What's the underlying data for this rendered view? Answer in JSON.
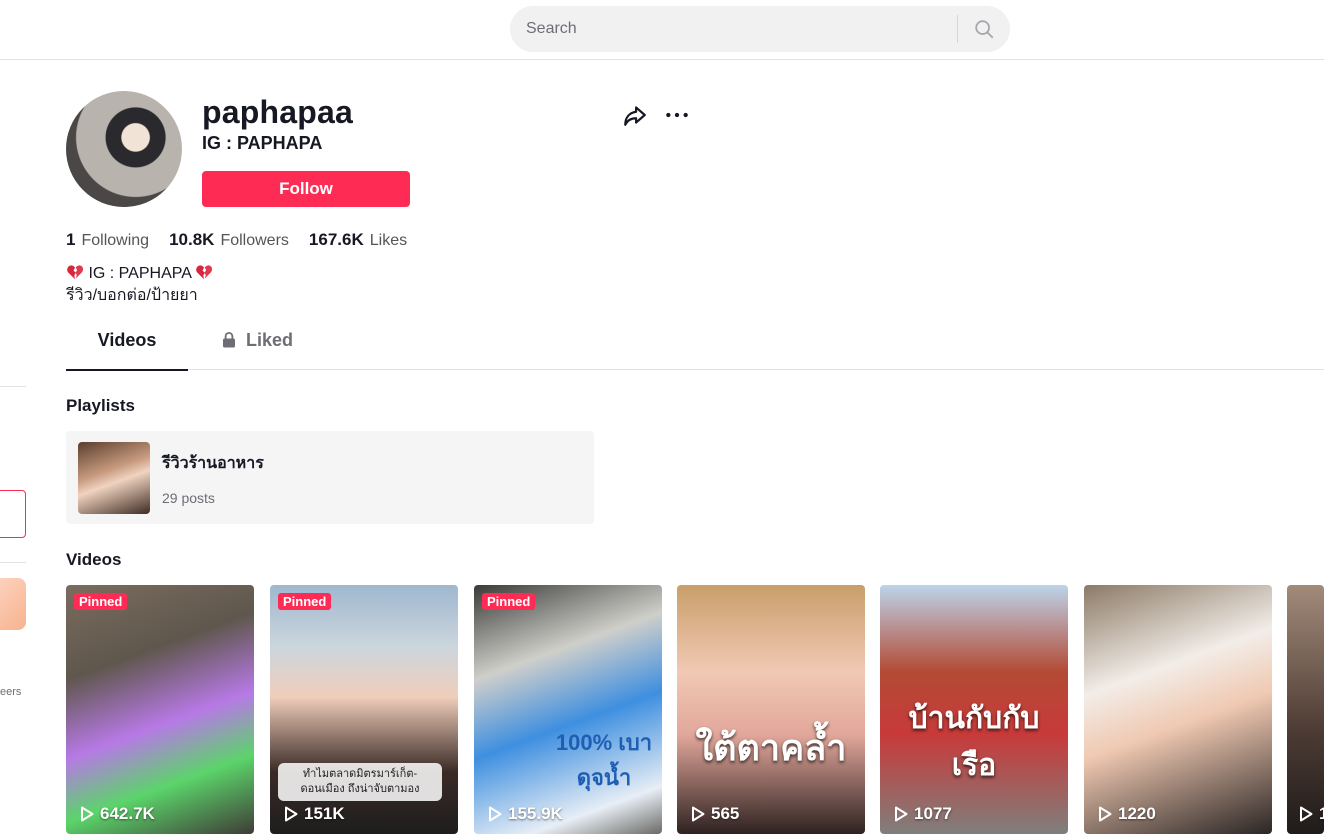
{
  "search": {
    "placeholder": "Search"
  },
  "sidebar": {
    "partial_text": "eers"
  },
  "profile": {
    "username": "paphapaa",
    "nickname": "IG : PAPHAPA",
    "follow_label": "Follow",
    "stats": {
      "following_count": "1",
      "following_label": "Following",
      "followers_count": "10.8K",
      "followers_label": "Followers",
      "likes_count": "167.6K",
      "likes_label": "Likes"
    },
    "bio_line1": "IG : PAPHAPA",
    "bio_line2": "รีวิว/บอกต่อ/ป้ายยา"
  },
  "tabs": {
    "videos": "Videos",
    "liked": "Liked"
  },
  "playlists": {
    "title": "Playlists",
    "items": [
      {
        "name": "รีวิวร้านอาหาร",
        "count": "29 posts"
      }
    ]
  },
  "videos": {
    "title": "Videos",
    "pinned_label": "Pinned",
    "items": [
      {
        "views": "642.7K",
        "pinned": true
      },
      {
        "views": "151K",
        "pinned": true,
        "caption": "ทำไมตลาดมิตรมาร์เก็ต-ดอนเมือง ถึงน่าจับตามอง"
      },
      {
        "views": "155.9K",
        "pinned": true,
        "caption": "100% เบาดุจน้ำ"
      },
      {
        "views": "565",
        "pinned": false,
        "caption": "ใต้ตาคล้ำ"
      },
      {
        "views": "1077",
        "pinned": false,
        "caption": "บ้านกับกับเรือ"
      },
      {
        "views": "1220",
        "pinned": false
      },
      {
        "views": "1",
        "pinned": false
      }
    ]
  },
  "colors": {
    "accent": "#fe2c55",
    "text": "#161823",
    "muted": "#6d6e74"
  }
}
